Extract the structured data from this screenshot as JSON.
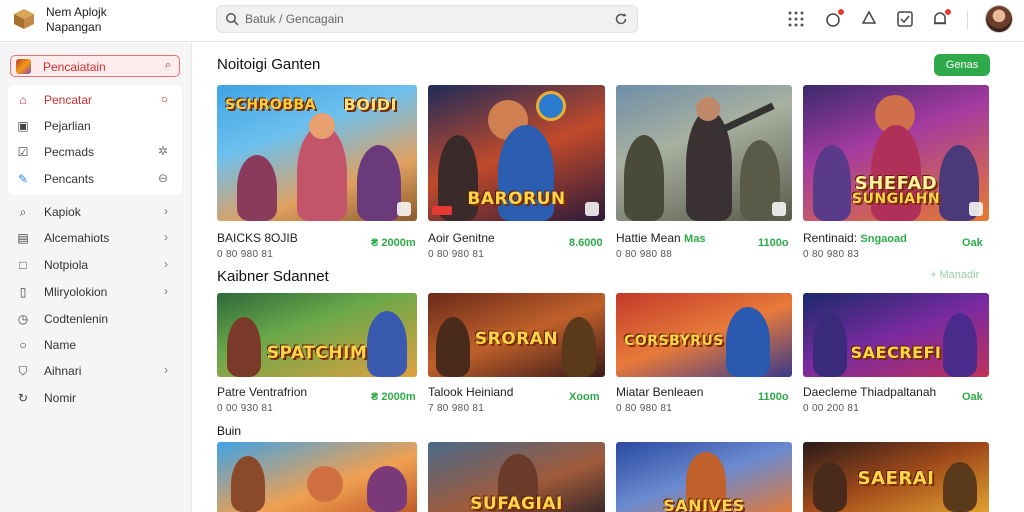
{
  "header": {
    "app_name_line1": "Nem Aplojk",
    "app_name_line2": "Napangan",
    "search_text": "Batuk / Gencagain",
    "icons": [
      "grid-icon",
      "notification-icon",
      "recycle-icon",
      "checkbox-icon",
      "bell-icon"
    ]
  },
  "sidebar": {
    "active": {
      "label": "Pencaiatain",
      "end": "⌕"
    },
    "group": [
      {
        "label": "Pencatar",
        "icon": "home-icon",
        "end": "○",
        "red": true
      },
      {
        "label": "Pejarlian",
        "icon": "image-icon",
        "end": ""
      },
      {
        "label": "Pecmads",
        "icon": "check-icon",
        "end": "✲"
      },
      {
        "label": "Pencants",
        "icon": "pen-icon",
        "end": "⊖"
      }
    ],
    "items": [
      {
        "label": "Kapiok",
        "icon": "search-icon",
        "end": "›"
      },
      {
        "label": "Alcemahiots",
        "icon": "doc-icon",
        "end": "›"
      },
      {
        "label": "Notpiola",
        "icon": "square-icon",
        "end": "›"
      },
      {
        "label": "Mliryolokion",
        "icon": "book-icon",
        "end": "›"
      },
      {
        "label": "Codtenlenin",
        "icon": "clock-icon",
        "end": ""
      },
      {
        "label": "Name",
        "icon": "circle-icon",
        "end": ""
      },
      {
        "label": "Aihnari",
        "icon": "shield-icon",
        "end": "›"
      },
      {
        "label": "Nomir",
        "icon": "refresh-icon",
        "end": ""
      }
    ]
  },
  "main": {
    "section1_title": "Noitoigi Ganten",
    "section1_button": "Genas",
    "section2_title": "Kaibner Sdannet",
    "section2_link": "+ Manadir",
    "section3_title": "Buin",
    "row1": [
      {
        "art": "SCHROBBA",
        "art2": "BOIDI",
        "title": "BAICKS 8OJIB",
        "meta": "0 80 980 81",
        "price": "₴ 2000m"
      },
      {
        "art": "BARORUN",
        "art2": "",
        "title": "Aoir Genitne",
        "meta": "0 80 980 81",
        "price": "8.6000"
      },
      {
        "art": "",
        "art2": "",
        "title": "Hattie Mean",
        "title2": "Mas",
        "meta": "0 80 980 88",
        "price": "1100o"
      },
      {
        "art": "SHEFAD",
        "art2": "SUNGIAHN",
        "title": "Rentinaid:",
        "title2": "Sngaoad",
        "meta": "0 80 980 83",
        "price": "Oak"
      }
    ],
    "row2": [
      {
        "art": "SPATCHIM",
        "art2": "",
        "title": "Patre Ventrafrion",
        "meta": "0 00 930 81",
        "price": "₴ 2000m"
      },
      {
        "art": "SRORAN",
        "art2": "",
        "title": "Talook Heiniand",
        "meta": "7 80 980 81",
        "price": "Xoom"
      },
      {
        "art": "CORSBYRUS",
        "art2": "",
        "title": "Miatar Benleaen",
        "meta": "0 80 980 81",
        "price": "1100o"
      },
      {
        "art": "SAECREFI",
        "art2": "",
        "title": "Daecleme Thiadpaltanah",
        "meta": "0 00 200 81",
        "price": "Oak"
      }
    ],
    "row3": [
      {
        "art": ""
      },
      {
        "art": "SUFAGIAI"
      },
      {
        "art": "SANIVES"
      },
      {
        "art": "SAERAI"
      }
    ]
  },
  "colors": {
    "accent_red": "#d32f2f",
    "accent_green": "#2eaa4a"
  }
}
